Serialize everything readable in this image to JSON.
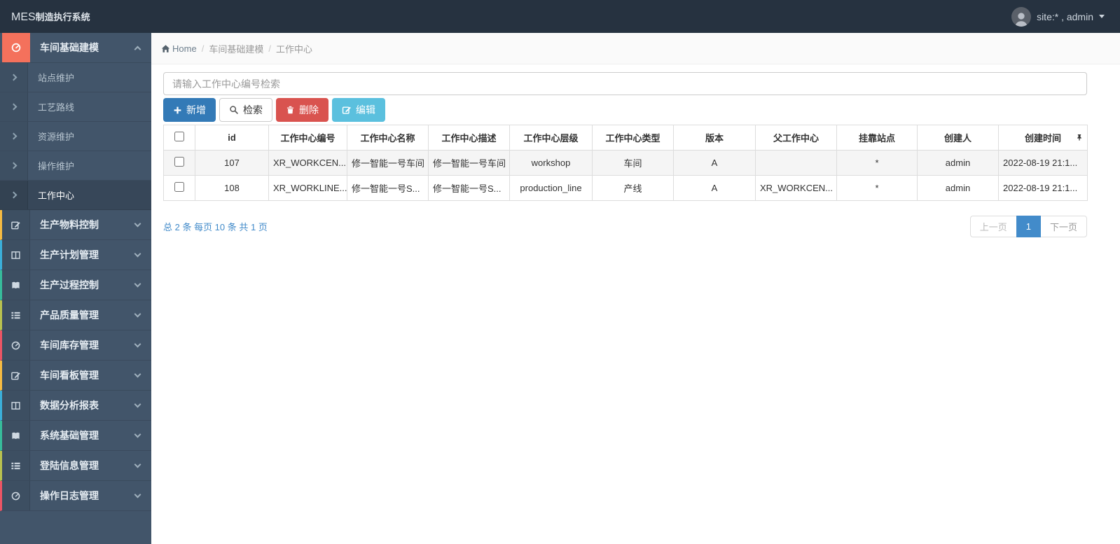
{
  "topbar": {
    "logo_bold": "MES",
    "logo_rest": "制造执行系统",
    "user_label": "site:* , admin"
  },
  "breadcrumb": {
    "home": "Home",
    "separator": "/",
    "items": [
      "车间基础建模",
      "工作中心"
    ]
  },
  "sidebar": {
    "group": {
      "label": "车间基础建模",
      "accent": "#f4715c",
      "children": [
        {
          "label": "站点维护"
        },
        {
          "label": "工艺路线"
        },
        {
          "label": "资源维护"
        },
        {
          "label": "操作维护"
        },
        {
          "label": "工作中心"
        }
      ]
    },
    "items": [
      {
        "label": "生产物料控制",
        "accent": "#f6bb42"
      },
      {
        "label": "生产计划管理",
        "accent": "#3bafda"
      },
      {
        "label": "生产过程控制",
        "accent": "#37bc9b"
      },
      {
        "label": "产品质量管理",
        "accent": "#b9c24f"
      },
      {
        "label": "车间库存管理",
        "accent": "#ed5565"
      },
      {
        "label": "车间看板管理",
        "accent": "#f6bb42"
      },
      {
        "label": "数据分析报表",
        "accent": "#3bafda"
      },
      {
        "label": "系统基础管理",
        "accent": "#37bc9b"
      },
      {
        "label": "登陆信息管理",
        "accent": "#b9c24f"
      },
      {
        "label": "操作日志管理",
        "accent": "#ed5565"
      }
    ]
  },
  "search": {
    "placeholder": "请输入工作中心编号检索"
  },
  "toolbar": {
    "add": "新增",
    "search": "检索",
    "delete": "删除",
    "edit": "编辑"
  },
  "table": {
    "columns": [
      "id",
      "工作中心编号",
      "工作中心名称",
      "工作中心描述",
      "工作中心层级",
      "工作中心类型",
      "版本",
      "父工作中心",
      "挂靠站点",
      "创建人",
      "创建时间"
    ],
    "rows": [
      {
        "id": "107",
        "code": "XR_WORKCEN...",
        "name": "修一智能一号车间",
        "desc": "修一智能一号车间",
        "level": "workshop",
        "type": "车间",
        "version": "A",
        "parent": "",
        "station": "*",
        "creator": "admin",
        "created": "2022-08-19 21:1..."
      },
      {
        "id": "108",
        "code": "XR_WORKLINE...",
        "name": "修一智能一号S...",
        "desc": "修一智能一号S...",
        "level": "production_line",
        "type": "产线",
        "version": "A",
        "parent": "XR_WORKCEN...",
        "station": "*",
        "creator": "admin",
        "created": "2022-08-19 21:1..."
      }
    ]
  },
  "pagination": {
    "summary": "总 2 条  每页 10 条  共 1 页",
    "prev": "上一页",
    "current": "1",
    "next": "下一页"
  },
  "colors": {
    "primary": "#337ab7",
    "danger": "#d9534f",
    "info": "#5bc0de",
    "link": "#428bca"
  }
}
